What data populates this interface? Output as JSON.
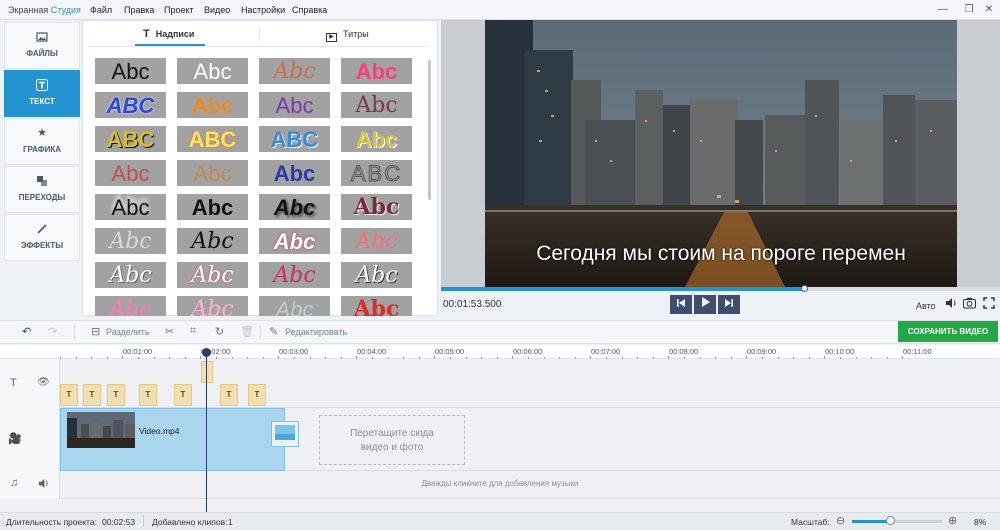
{
  "app": {
    "title_part1": "Экранная",
    "title_part2": "Студия"
  },
  "menu": [
    "Файл",
    "Правка",
    "Проект",
    "Видео",
    "Настройки",
    "Справка"
  ],
  "window_controls": {
    "minimize": "—",
    "restore": "❐",
    "close": "✕"
  },
  "sidebar": {
    "items": [
      {
        "label": "ФАЙЛЫ",
        "icon": "image-icon",
        "active": false
      },
      {
        "label": "ТЕКСТ",
        "icon": "text-icon",
        "active": true
      },
      {
        "label": "ГРАФИКА",
        "icon": "star-icon",
        "active": false
      },
      {
        "label": "ПЕРЕХОДЫ",
        "icon": "transitions-icon",
        "active": false
      },
      {
        "label": "ЭФФЕКТЫ",
        "icon": "wand-icon",
        "active": false
      }
    ]
  },
  "text_panel": {
    "tabs": [
      {
        "label": "Надписи",
        "active": true
      },
      {
        "label": "Титры",
        "active": false
      }
    ],
    "style_tiles": [
      "Abc",
      "Abc",
      "Abc",
      "Abc",
      "ABC",
      "Abc",
      "Abc",
      "Abc",
      "ABC",
      "ABC",
      "ABC",
      "Abc",
      "Abc",
      "Abc",
      "Abc",
      "ABC",
      "Abc",
      "Abc",
      "Abc",
      "Abc",
      "Abc",
      "Abc",
      "Abc",
      "Abc",
      "Abc",
      "Abc",
      "Abc",
      "Abc",
      "Abc",
      "Abc",
      "Abc",
      "Abc"
    ]
  },
  "preview": {
    "caption": "Сегодня мы стоим на пороге перемен",
    "timecode": "00:01:53.500",
    "progress_fraction": 0.65,
    "quality_label": "Авто"
  },
  "toolbar": {
    "split_label": "Разделить",
    "edit_label": "Редактировать",
    "save_label": "СОХРАНИТЬ ВИДЕО"
  },
  "timeline": {
    "ruler_ticks": [
      "00:01:00",
      "00:02:00",
      "00:03:00",
      "00:04:00",
      "00:05:00",
      "00:06:00",
      "00:07:00",
      "00:08:00",
      "00:09:00",
      "00:10:00",
      "00:11:00"
    ],
    "video_clip_name": "Video.mp4",
    "drop_zone_line1": "Перетащите сюда",
    "drop_zone_line2": "видео и фото",
    "music_hint": "Дважды кликните для добавления музыки"
  },
  "status": {
    "duration_label": "Длительность проекта:",
    "duration_value": "00:02:53",
    "clips_label": "Добавлено клипов:",
    "clips_value": "1",
    "zoom_label": "Масштаб:",
    "zoom_value": "8%"
  },
  "colors": {
    "accent": "#2394d1",
    "save_button": "#22a844",
    "playback_button": "#3d4e6e",
    "text_clip": "#f1dfb0",
    "video_clip": "#a9d6ee"
  }
}
